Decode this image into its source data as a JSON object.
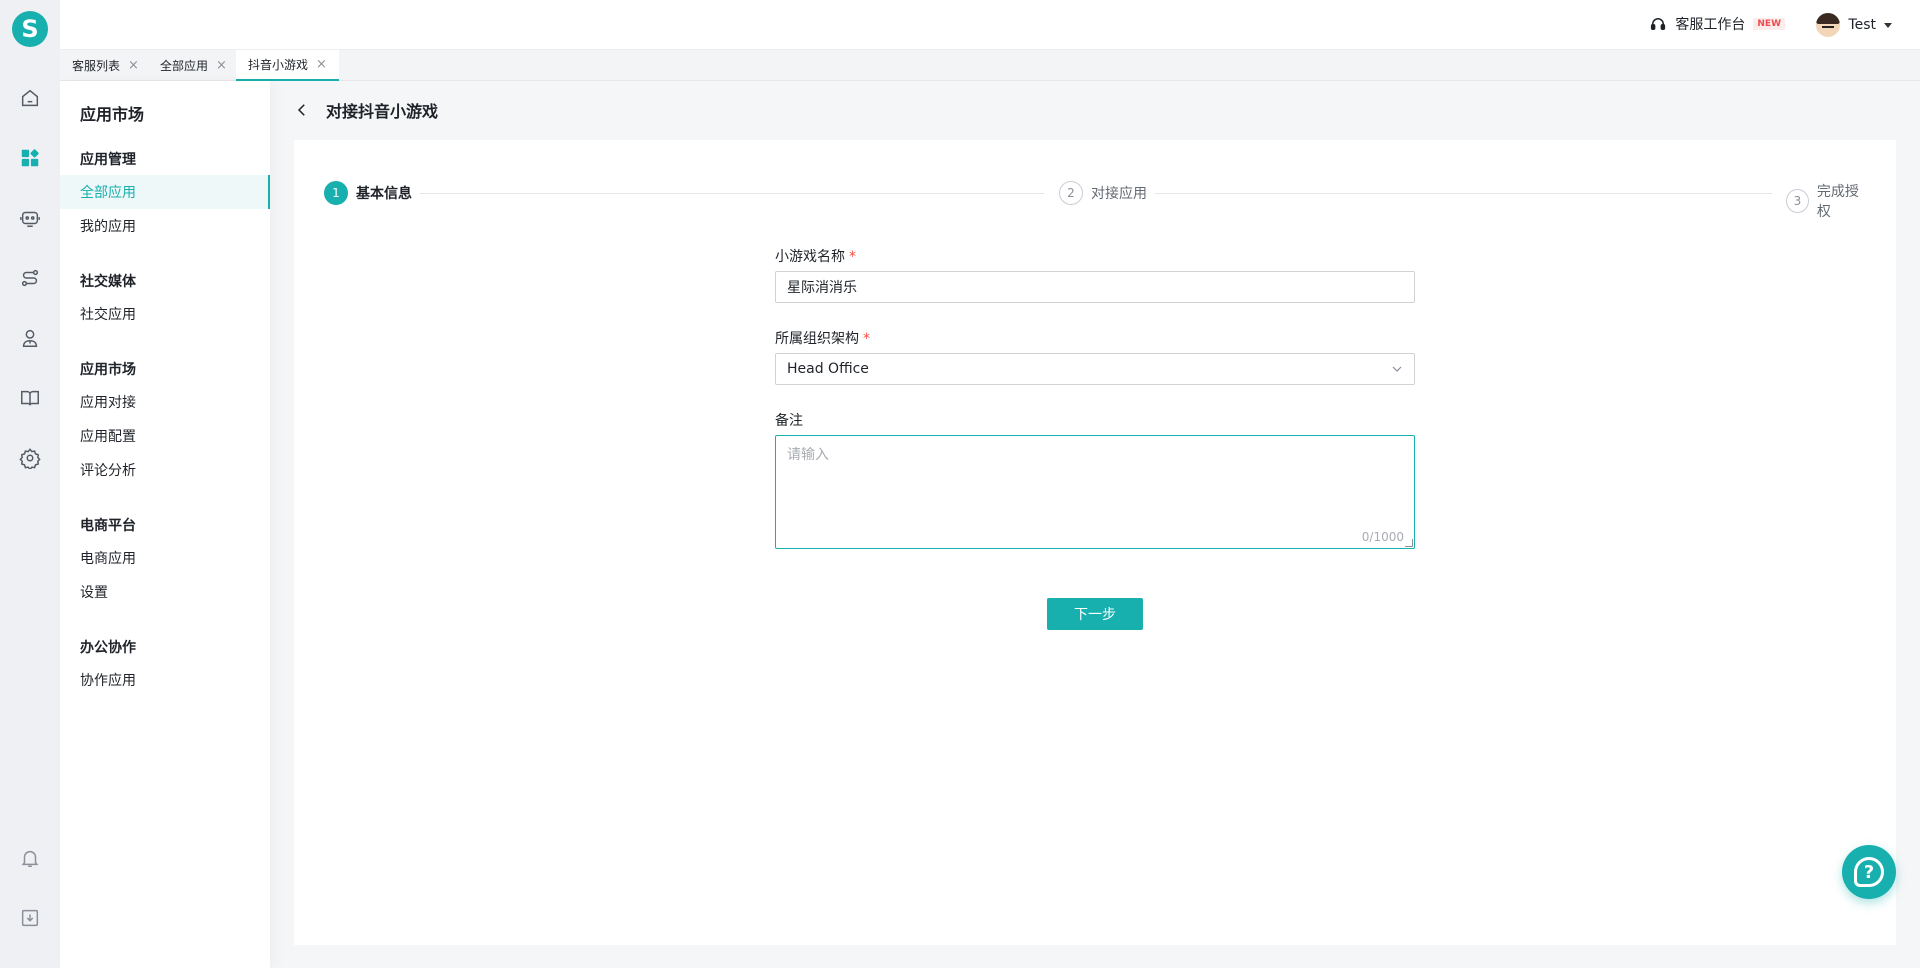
{
  "rail": {
    "logo_letter": "S",
    "icons": [
      "home-icon",
      "apps-icon",
      "robot-icon",
      "route-icon",
      "agent-icon",
      "book-icon",
      "settings-icon",
      "bell-icon",
      "download-icon"
    ]
  },
  "topbar": {
    "workbench_label": "客服工作台",
    "workbench_badge": "NEW",
    "user_name": "Test"
  },
  "tabs": [
    {
      "label": "客服列表",
      "close": "×"
    },
    {
      "label": "全部应用",
      "close": "×"
    },
    {
      "label": "抖音小游戏",
      "close": "×"
    }
  ],
  "sidebar": {
    "title": "应用市场",
    "groups": [
      {
        "title": "应用管理",
        "items": [
          "全部应用",
          "我的应用"
        ]
      },
      {
        "title": "社交媒体",
        "items": [
          "社交应用"
        ]
      },
      {
        "title": "应用市场",
        "items": [
          "应用对接",
          "应用配置",
          "评论分析"
        ]
      },
      {
        "title": "电商平台",
        "items": [
          "电商应用",
          "设置"
        ]
      },
      {
        "title": "办公协作",
        "items": [
          "协作应用"
        ]
      }
    ],
    "active_item": "全部应用"
  },
  "page": {
    "title": "对接抖音小游戏"
  },
  "steps": [
    {
      "num": "1",
      "label": "基本信息"
    },
    {
      "num": "2",
      "label": "对接应用"
    },
    {
      "num": "3",
      "label": "完成授权"
    }
  ],
  "form": {
    "name_label": "小游戏名称",
    "name_value": "星际消消乐",
    "org_label": "所属组织架构",
    "org_value": "Head Office",
    "note_label": "备注",
    "note_placeholder": "请输入",
    "note_counter": "0/1000",
    "required_mark": "*",
    "next_label": "下一步"
  },
  "colors": {
    "accent": "#17b0ae",
    "required": "#f54a45"
  },
  "help": {
    "glyph": "?"
  }
}
